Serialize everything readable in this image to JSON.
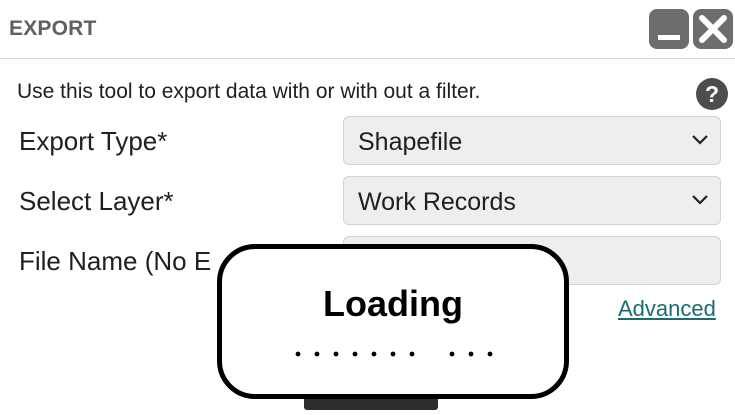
{
  "window": {
    "title": "EXPORT",
    "minimize_icon": "minimize-icon",
    "close_icon": "close-icon"
  },
  "intro_text": "Use this tool to export data with or with out a filter.",
  "help_icon": "?",
  "form": {
    "export_type": {
      "label": "Export Type*",
      "value": "Shapefile"
    },
    "select_layer": {
      "label": "Select Layer*",
      "value": "Work Records"
    },
    "file_name": {
      "label": "File Name (No E",
      "value": ""
    }
  },
  "advanced_link": "Advanced",
  "loading": {
    "title": "Loading",
    "dots": "........ ..."
  },
  "colors": {
    "title_text": "#616161",
    "window_button": "#6d6d6d",
    "link": "#1a6b73",
    "field_bg": "#eeeeee"
  }
}
